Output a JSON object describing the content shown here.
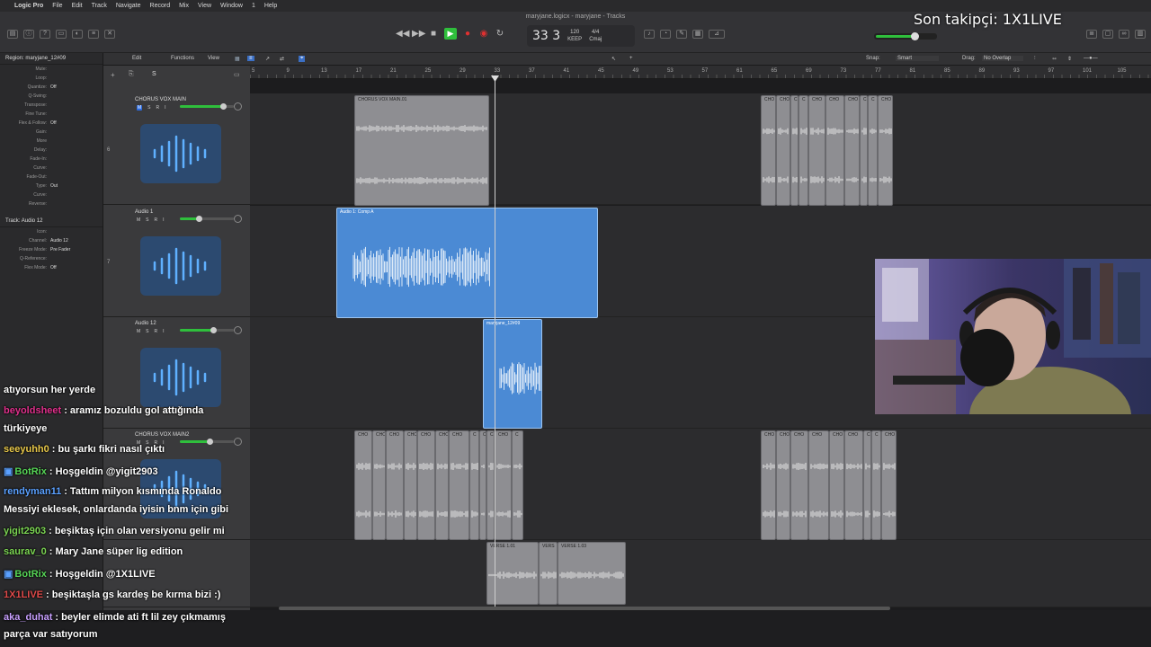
{
  "menubar": {
    "apple": "",
    "items": [
      "Logic Pro",
      "File",
      "Edit",
      "Track",
      "Navigate",
      "Record",
      "Mix",
      "View",
      "Window",
      "1",
      "Help"
    ]
  },
  "window": {
    "title": "maryjane.logicx - maryjane - Tracks"
  },
  "transport": {
    "position": "33  3",
    "tempo": "120",
    "tempo_sub": "KEEP",
    "signature": "4/4",
    "key": "Cmaj"
  },
  "overlay": {
    "last_follower": "Son takipçi: 1X1LIVE"
  },
  "master_volume_level": 0.68,
  "inspector": {
    "region_header": "Region: maryjane_12#09",
    "region_rows": [
      {
        "k": "Mute:",
        "v": ""
      },
      {
        "k": "Loop:",
        "v": ""
      },
      {
        "k": "Quantize:",
        "v": "Off"
      },
      {
        "k": "Q-Swing:",
        "v": ""
      },
      {
        "k": "Transpose:",
        "v": ""
      },
      {
        "k": "Fine Tune:",
        "v": ""
      },
      {
        "k": "Flex & Follow:",
        "v": "Off"
      },
      {
        "k": "Gain:",
        "v": ""
      },
      {
        "k": "More",
        "v": ""
      },
      {
        "k": "Delay:",
        "v": ""
      },
      {
        "k": "Fade-In:",
        "v": ""
      },
      {
        "k": "Curve:",
        "v": ""
      },
      {
        "k": "Fade-Out:",
        "v": ""
      },
      {
        "k": "Type:",
        "v": "Out"
      },
      {
        "k": "Curve:",
        "v": ""
      },
      {
        "k": "Reverse:",
        "v": ""
      }
    ],
    "track_header": "Track: Audio 12",
    "track_rows": [
      {
        "k": "Icon:",
        "v": ""
      },
      {
        "k": "Channel:",
        "v": "Audio 12"
      },
      {
        "k": "Freeze Mode:",
        "v": "Pre Fader"
      },
      {
        "k": "Q-Reference:",
        "v": ""
      },
      {
        "k": "Flex Mode:",
        "v": "Off"
      }
    ]
  },
  "tracks_toolbar": {
    "edit": "Edit",
    "functions": "Functions",
    "view": "View",
    "snap_label": "Snap:",
    "snap_value": "Smart",
    "drag_label": "Drag:",
    "drag_value": "No Overlap"
  },
  "ruler": {
    "bars": [
      "5",
      "9",
      "13",
      "17",
      "21",
      "25",
      "29",
      "33",
      "37",
      "41",
      "45",
      "49",
      "53",
      "57",
      "61",
      "65",
      "69",
      "73",
      "77",
      "81",
      "85",
      "89",
      "93",
      "97",
      "101",
      "105"
    ]
  },
  "tracks": [
    {
      "number": "6",
      "name": "CHORUS VOX MAIN",
      "fader": 0.8
    },
    {
      "number": "7",
      "name": "Audio 1",
      "fader": 0.35
    },
    {
      "number": "",
      "name": "Audio 12",
      "fader": 0.62
    },
    {
      "number": "",
      "name": "CHORUS VOX MAIN2",
      "fader": 0.55
    }
  ],
  "msri": {
    "m": "M",
    "s": "S",
    "r": "R",
    "i": "I"
  },
  "regions": {
    "chorus1": "CHORUS VOX MAIN.01",
    "audio1": "Audio 1: Comp A",
    "maryjane": "maryjane_12#09",
    "cho": "CHO",
    "c": "C",
    "verse1": "VERSE 1.01",
    "verse_short": "VERS",
    "verse3": "VERSE 1.03"
  },
  "chat": [
    {
      "user": "",
      "user_color": "#ffffff",
      "text": "atıyorsun her yerde"
    },
    {
      "user": "beyoldsheet",
      "user_color": "#e0308c",
      "text": ": aramız bozuldu gol attığında"
    },
    {
      "user": "",
      "user_color": "#ffffff",
      "text": "türkiyeye"
    },
    {
      "user": "seeyuhh0",
      "user_color": "#e8c84a",
      "text": ": bu şarkı fikri nasıl çıktı"
    },
    {
      "user": "BotRix",
      "user_color": "#57d657",
      "text": ": Hoşgeldin @yigit2903"
    },
    {
      "user": "rendyman11",
      "user_color": "#5aa0ff",
      "text": ": Tattım milyon kısmında Ronaldo"
    },
    {
      "user": "",
      "user_color": "#ffffff",
      "text": "Messiyi eklesek, onlardanda iyisin bnm için gibi"
    },
    {
      "user": "yigit2903",
      "user_color": "#7cd653",
      "text": ": beşiktaş için olan versiyonu gelir mi"
    },
    {
      "user": "saurav_0",
      "user_color": "#7cd653",
      "text": ": Mary Jane süper lig edition"
    },
    {
      "user": "BotRix",
      "user_color": "#57d657",
      "text": ": Hoşgeldin @1X1LIVE"
    },
    {
      "user": "1X1LIVE",
      "user_color": "#e04a4a",
      "text": ": beşiktaşla gs kardeş be kırma bizi :)"
    },
    {
      "user": "aka_duhat",
      "user_color": "#c8a0ff",
      "text": ": beyler elimde ati ft lil zey çıkmamış"
    },
    {
      "user": "",
      "user_color": "#ffffff",
      "text": "parça var satıyorum"
    }
  ],
  "colors": {
    "accent_green": "#2fbf3c",
    "record_red": "#e03030",
    "region_blue": "#4b8ad4",
    "region_gray": "#8e8e92",
    "track_icon_bg": "#2c4a70"
  },
  "icons": [
    "play-icon",
    "stop-icon",
    "record-icon",
    "rewind-icon",
    "forward-icon",
    "cycle-icon",
    "waveform-icon"
  ]
}
